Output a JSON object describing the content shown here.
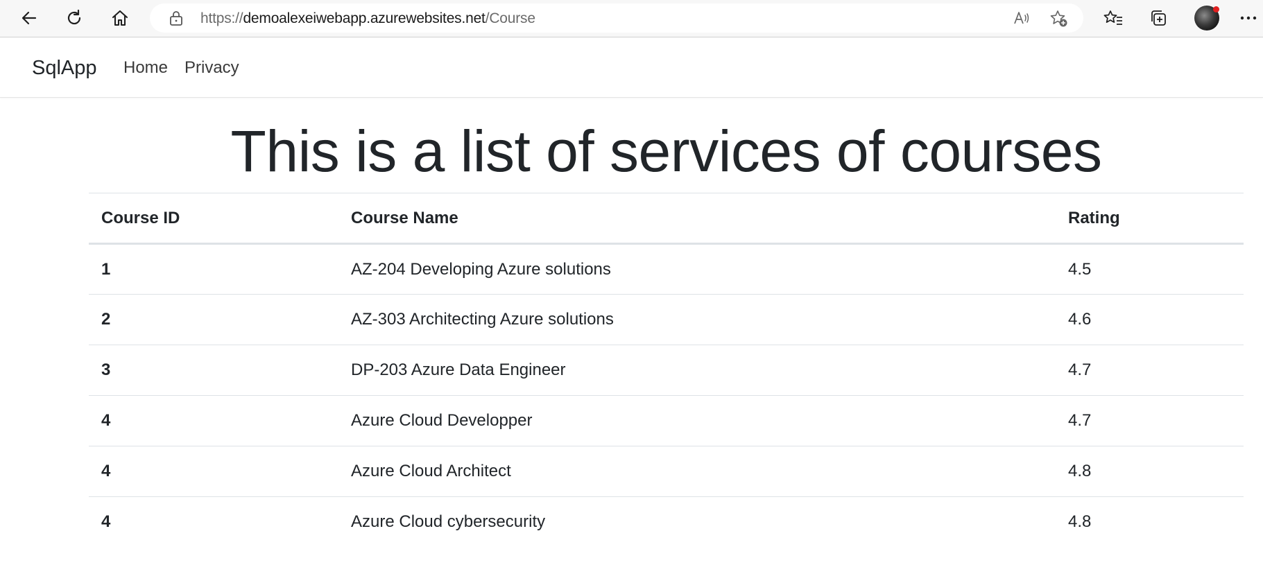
{
  "browser": {
    "url_scheme": "https://",
    "url_host": "demoalexeiwebapp.azurewebsites.net",
    "url_path": "/Course",
    "icons": [
      "back-icon",
      "refresh-icon",
      "home-icon",
      "lock-icon",
      "read-aloud-icon",
      "add-favorite-icon",
      "favorites-icon",
      "collections-icon",
      "profile-avatar",
      "more-icon"
    ],
    "notification_color": "#e02020"
  },
  "navbar": {
    "brand": "SqlApp",
    "links": [
      {
        "label": "Home"
      },
      {
        "label": "Privacy"
      }
    ]
  },
  "main": {
    "title": "This is a list of services of courses",
    "table": {
      "headers": [
        "Course ID",
        "Course Name",
        "Rating"
      ],
      "rows": [
        {
          "id": "1",
          "name": "AZ-204 Developing Azure solutions",
          "rating": "4.5"
        },
        {
          "id": "2",
          "name": "AZ-303 Architecting Azure solutions",
          "rating": "4.6"
        },
        {
          "id": "3",
          "name": "DP-203 Azure Data Engineer",
          "rating": "4.7"
        },
        {
          "id": "4",
          "name": "Azure Cloud Developper",
          "rating": "4.7"
        },
        {
          "id": "4",
          "name": "Azure Cloud Architect",
          "rating": "4.8"
        },
        {
          "id": "4",
          "name": "Azure Cloud cybersecurity",
          "rating": "4.8"
        }
      ]
    }
  }
}
